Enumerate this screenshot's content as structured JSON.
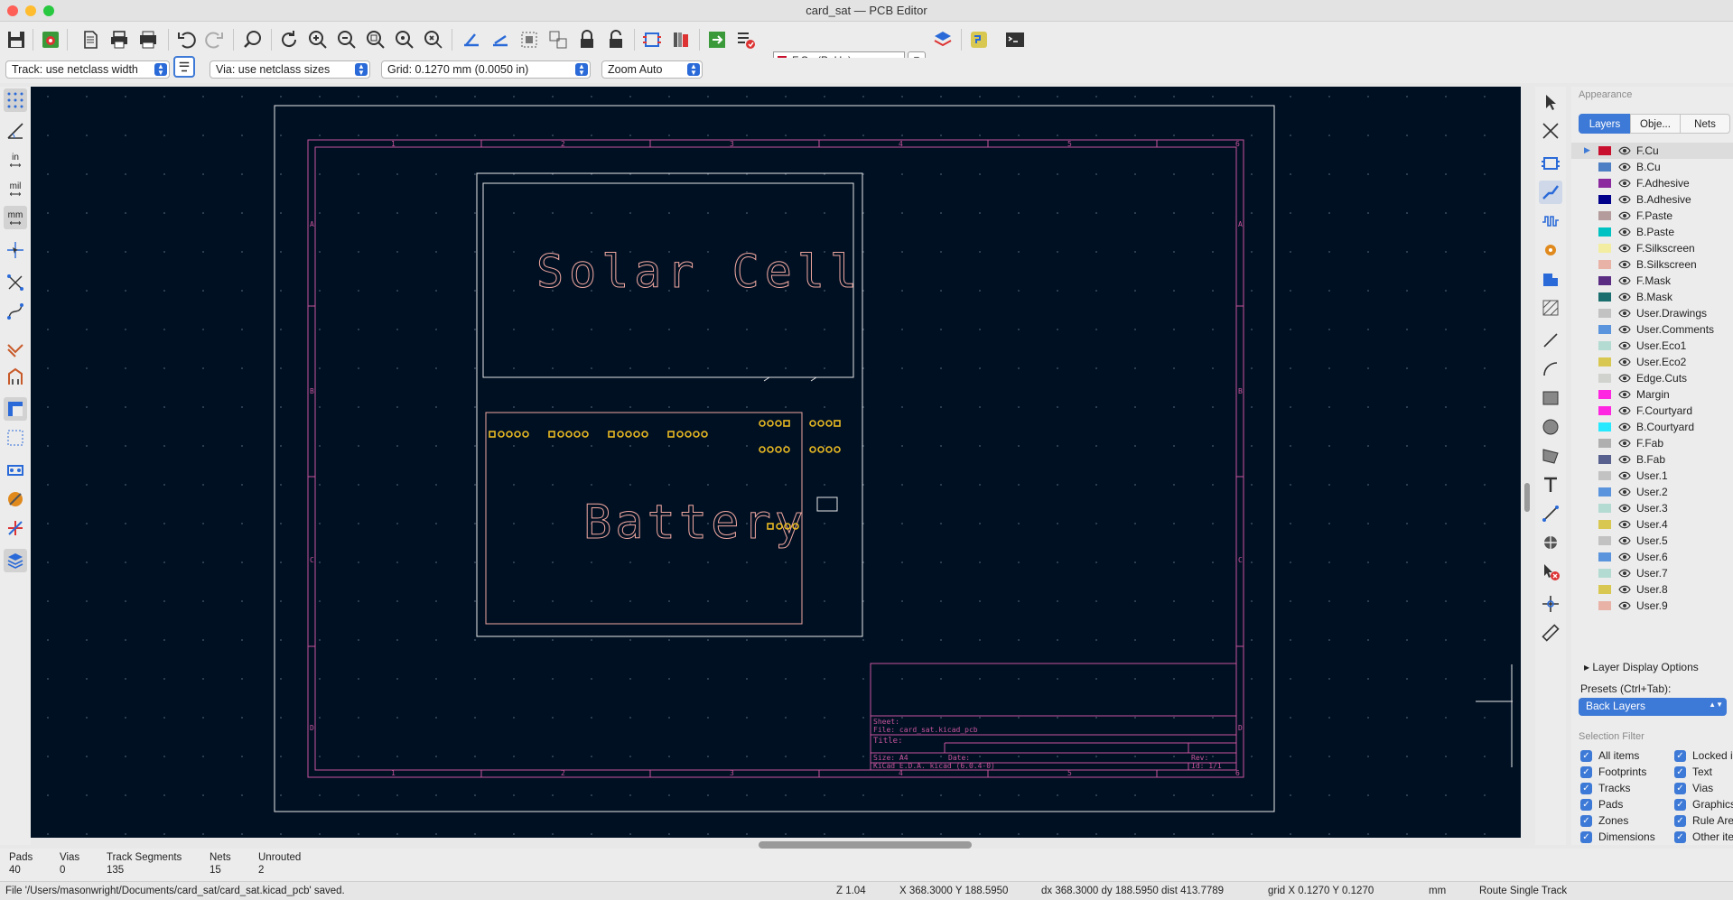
{
  "window": {
    "title": "card_sat — PCB Editor"
  },
  "toolbar": {
    "active_layer": "F.Cu (PgUp)",
    "active_layer_color": "#c8102e",
    "track_width": "Track: use netclass width",
    "via_size": "Via: use netclass sizes",
    "grid": "Grid: 0.1270 mm (0.0050 in)",
    "zoom": "Zoom Auto"
  },
  "left_toolbar": {
    "unit_in": "in",
    "unit_mil": "mil",
    "unit_mm": "mm"
  },
  "canvas": {
    "background": "#001023",
    "board_outline_color": "#f2f2f2",
    "sheet_frame_color": "#c8559c",
    "silkscreen_color": "#f0a8a0",
    "pad_color": "#e8b923",
    "frame_col_labels": [
      "1",
      "2",
      "3",
      "4",
      "5",
      "6"
    ],
    "frame_row_labels": [
      "A",
      "B",
      "C",
      "D"
    ],
    "solar_label": "Solar Cell",
    "battery_label": "Battery",
    "title_block": {
      "sheet": "Sheet:",
      "file": "File: card_sat.kicad_pcb",
      "title": "Title:",
      "size": "Size: A4",
      "date": "Date:",
      "rev": "Rev:",
      "tool": "KiCad E.D.A.  kicad (6.0.4-0)",
      "id": "Id: 1/1"
    }
  },
  "appearance": {
    "title": "Appearance",
    "tabs": [
      "Layers",
      "Obje...",
      "Nets"
    ],
    "layers": [
      {
        "name": "F.Cu",
        "color": "#c8102e",
        "selected": true
      },
      {
        "name": "B.Cu",
        "color": "#4d7fc4"
      },
      {
        "name": "F.Adhesive",
        "color": "#8b2a9e"
      },
      {
        "name": "B.Adhesive",
        "color": "#00008b"
      },
      {
        "name": "F.Paste",
        "color": "#b49c9c"
      },
      {
        "name": "B.Paste",
        "color": "#00c2c2"
      },
      {
        "name": "F.Silkscreen",
        "color": "#f2eda1"
      },
      {
        "name": "B.Silkscreen",
        "color": "#e8b2a7"
      },
      {
        "name": "F.Mask",
        "color": "#5a2d82"
      },
      {
        "name": "B.Mask",
        "color": "#1a6e6e"
      },
      {
        "name": "User.Drawings",
        "color": "#c2c2c2"
      },
      {
        "name": "User.Comments",
        "color": "#5994dc"
      },
      {
        "name": "User.Eco1",
        "color": "#b4dbd2"
      },
      {
        "name": "User.Eco2",
        "color": "#d8c852"
      },
      {
        "name": "Edge.Cuts",
        "color": "#d0d2cd"
      },
      {
        "name": "Margin",
        "color": "#ff26e2"
      },
      {
        "name": "F.Courtyard",
        "color": "#ff26e2"
      },
      {
        "name": "B.Courtyard",
        "color": "#26e9ff"
      },
      {
        "name": "F.Fab",
        "color": "#afafaf"
      },
      {
        "name": "B.Fab",
        "color": "#58608e"
      },
      {
        "name": "User.1",
        "color": "#c2c2c2"
      },
      {
        "name": "User.2",
        "color": "#5994dc"
      },
      {
        "name": "User.3",
        "color": "#b4dbd2"
      },
      {
        "name": "User.4",
        "color": "#d8c852"
      },
      {
        "name": "User.5",
        "color": "#c2c2c2"
      },
      {
        "name": "User.6",
        "color": "#5994dc"
      },
      {
        "name": "User.7",
        "color": "#b4dbd2"
      },
      {
        "name": "User.8",
        "color": "#d8c852"
      },
      {
        "name": "User.9",
        "color": "#e8b2a7"
      }
    ],
    "layer_display_options": "Layer Display Options",
    "presets_label": "Presets (Ctrl+Tab):",
    "preset_value": "Back Layers",
    "selection_filter_title": "Selection Filter",
    "filters_left": [
      "All items",
      "Footprints",
      "Tracks",
      "Pads",
      "Zones",
      "Dimensions"
    ],
    "filters_right": [
      "Locked items",
      "Text",
      "Vias",
      "Graphics",
      "Rule Areas",
      "Other items"
    ]
  },
  "stats": [
    {
      "label": "Pads",
      "value": "40"
    },
    {
      "label": "Vias",
      "value": "0"
    },
    {
      "label": "Track Segments",
      "value": "135"
    },
    {
      "label": "Nets",
      "value": "15"
    },
    {
      "label": "Unrouted",
      "value": "2"
    }
  ],
  "statusbar": {
    "message": "File '/Users/masonwright/Documents/card_sat/card_sat.kicad_pcb' saved.",
    "zoom": "Z 1.04",
    "xy": "X 368.3000  Y 188.5950",
    "delta": "dx 368.3000  dy 188.5950  dist 413.7789",
    "grid": "grid X 0.1270  Y 0.1270",
    "units": "mm",
    "tool": "Route Single Track"
  }
}
